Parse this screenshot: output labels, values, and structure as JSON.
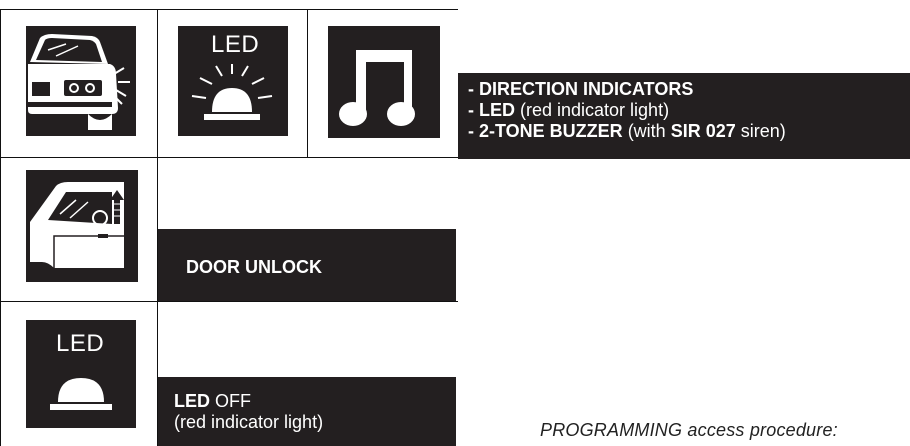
{
  "icons": {
    "car_front": "car-front-icon",
    "led_alarm": "led-flashing-icon",
    "music_note": "music-note-icon",
    "door": "door-unlock-icon",
    "led_off": "led-off-icon"
  },
  "led_label": "LED",
  "signals_panel": {
    "line1_dash": "- ",
    "line1_bold": "DIRECTION INDICATORS",
    "line2_dash": "- ",
    "line2_bold": "LED",
    "line2_rest": " (red indicator light)",
    "line3_dash": "- ",
    "line3_bold": "2-TONE BUZZER",
    "line3_mid": " (with ",
    "line3_bold2": "SIR 027",
    "line3_end": " siren)"
  },
  "door_panel": {
    "label": "DOOR UNLOCK"
  },
  "led_off_panel": {
    "bold": "LED",
    "rest": " OFF",
    "line2": "(red indicator light)"
  },
  "footer_text": "PROGRAMMING access procedure:",
  "colors": {
    "panel": "#231f20",
    "text_on_panel": "#ffffff"
  }
}
